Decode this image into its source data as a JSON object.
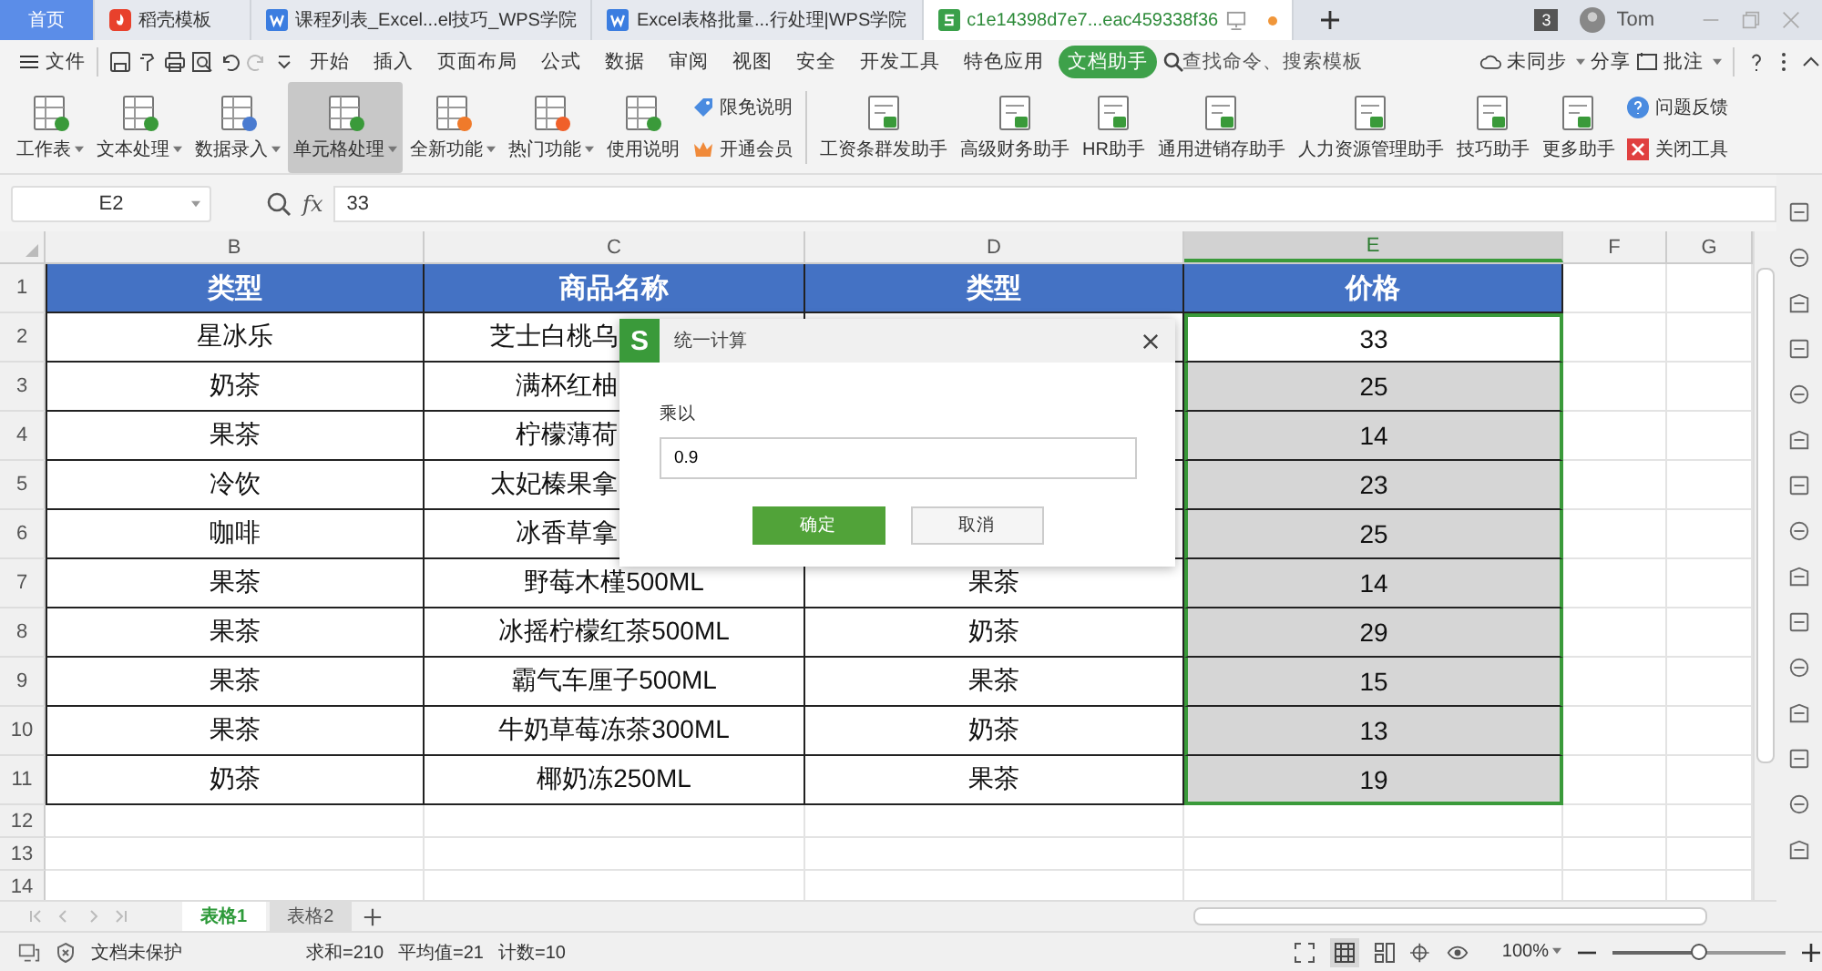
{
  "tabs": [
    {
      "label": "首页",
      "kind": "home",
      "selected": false
    },
    {
      "label": "稻壳模板",
      "kind": "docer",
      "selected": false
    },
    {
      "label": "课程列表_Excel...el技巧_WPS学院",
      "kind": "web",
      "selected": false
    },
    {
      "label": "Excel表格批量...行处理|WPS学院",
      "kind": "web",
      "selected": false
    },
    {
      "label": "c1e14398d7e7...eac459338f36",
      "kind": "sheet",
      "selected": true,
      "modified": true
    }
  ],
  "window_count": "3",
  "user": "Tom",
  "menu": {
    "file": "文件",
    "items": [
      {
        "label": "开始",
        "selected": false
      },
      {
        "label": "插入",
        "selected": false
      },
      {
        "label": "页面布局",
        "selected": false
      },
      {
        "label": "公式",
        "selected": false
      },
      {
        "label": "数据",
        "selected": false
      },
      {
        "label": "审阅",
        "selected": false
      },
      {
        "label": "视图",
        "selected": false
      },
      {
        "label": "安全",
        "selected": false
      },
      {
        "label": "开发工具",
        "selected": false
      },
      {
        "label": "特色应用",
        "selected": false
      },
      {
        "label": "文档助手",
        "selected": true
      }
    ],
    "search": "查找命令、搜索模板",
    "sync": "未同步",
    "share": "分享",
    "comment": "批注"
  },
  "ribbon": {
    "tools": [
      {
        "label": "工作表",
        "dropdown": true,
        "selected": false
      },
      {
        "label": "文本处理",
        "dropdown": true,
        "selected": false
      },
      {
        "label": "数据录入",
        "dropdown": true,
        "selected": false
      },
      {
        "label": "单元格处理",
        "dropdown": true,
        "selected": true
      },
      {
        "label": "全新功能",
        "dropdown": true,
        "selected": false
      },
      {
        "label": "热门功能",
        "dropdown": true,
        "selected": false
      },
      {
        "label": "使用说明",
        "dropdown": false,
        "selected": false
      }
    ],
    "links_1": [
      "限免说明",
      "开通会员"
    ],
    "assistants": [
      "工资条群发助手",
      "高级财务助手",
      "HR助手",
      "通用进销存助手",
      "人力资源管理助手",
      "技巧助手",
      "更多助手"
    ],
    "links_2": [
      "问题反馈",
      "关闭工具"
    ]
  },
  "formula": {
    "name_box": "E2",
    "fx": "fx",
    "value": "33"
  },
  "sheet": {
    "columns": [
      {
        "label": "B",
        "selected": false
      },
      {
        "label": "C",
        "selected": false
      },
      {
        "label": "D",
        "selected": false
      },
      {
        "label": "E",
        "selected": true
      },
      {
        "label": "F",
        "selected": false
      },
      {
        "label": "G",
        "selected": false
      }
    ],
    "header": {
      "number": "1",
      "cells": [
        "类型",
        "商品名称",
        "类型",
        "价格"
      ]
    },
    "rows": [
      {
        "number": "2",
        "b": "星冰乐",
        "c": "芝士白桃乌",
        "c_covered": true,
        "price": "33",
        "selected": true,
        "active": true
      },
      {
        "number": "3",
        "b": "奶茶",
        "c": "满杯红柚",
        "c_covered": true,
        "price": "25",
        "selected": true,
        "active": false
      },
      {
        "number": "4",
        "b": "果茶",
        "c": "柠檬薄荷",
        "c_covered": true,
        "price": "14",
        "selected": true,
        "active": false
      },
      {
        "number": "5",
        "b": "冷饮",
        "c": "太妃榛果拿",
        "c_covered": true,
        "price": "23",
        "selected": true,
        "active": false
      },
      {
        "number": "6",
        "b": "咖啡",
        "c": "冰香草拿",
        "c_covered": true,
        "price": "25",
        "selected": true,
        "active": false
      },
      {
        "number": "7",
        "b": "果茶",
        "c": "野莓木槿500ML",
        "c_covered": false,
        "d": "果茶",
        "price": "14",
        "selected": true,
        "active": false
      },
      {
        "number": "8",
        "b": "果茶",
        "c": "冰摇柠檬红茶500ML",
        "c_covered": false,
        "d": "奶茶",
        "price": "29",
        "selected": true,
        "active": false
      },
      {
        "number": "9",
        "b": "果茶",
        "c": "霸气车厘子500ML",
        "c_covered": false,
        "d": "果茶",
        "price": "15",
        "selected": true,
        "active": false
      },
      {
        "number": "10",
        "b": "果茶",
        "c": "牛奶草莓冻茶300ML",
        "c_covered": false,
        "d": "奶茶",
        "price": "13",
        "selected": true,
        "active": false
      },
      {
        "number": "11",
        "b": "奶茶",
        "c": "椰奶冻250ML",
        "c_covered": false,
        "d": "果茶",
        "price": "19",
        "selected": true,
        "active": false
      }
    ],
    "empty_rows": [
      "12",
      "13",
      "14"
    ]
  },
  "dialog": {
    "logo": "S",
    "title": "统一计算",
    "label": "乘以",
    "value": "0.9",
    "ok": "确定",
    "cancel": "取消"
  },
  "sheets": [
    {
      "label": "表格1",
      "selected": true
    },
    {
      "label": "表格2",
      "selected": false
    }
  ],
  "status": {
    "protection": "文档未保护",
    "sum": "求和=210",
    "average": "平均值=21",
    "count": "计数=10",
    "zoom": "100%",
    "zoom_slider": {
      "level": 0.5
    }
  }
}
